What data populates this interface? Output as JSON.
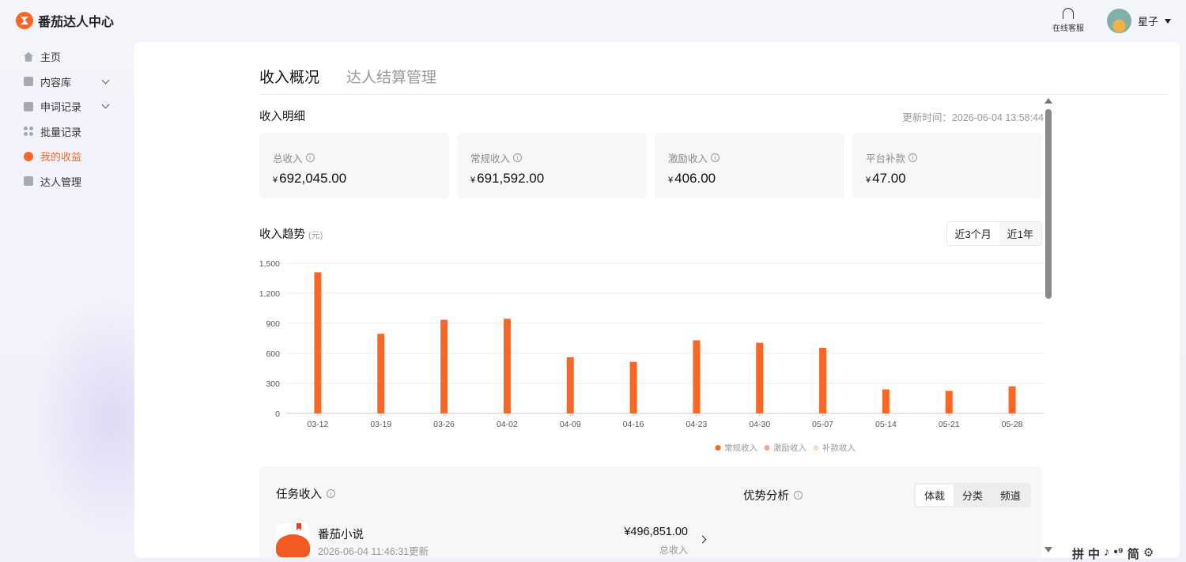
{
  "app": {
    "name": "番茄达人中心"
  },
  "header": {
    "support_label": "在线客服",
    "user_name": "星子"
  },
  "sidebar": {
    "items": [
      {
        "label": "主页",
        "icon": "home-icon"
      },
      {
        "label": "内容库",
        "icon": "content-library-icon",
        "expandable": true
      },
      {
        "label": "申词记录",
        "icon": "document-icon",
        "expandable": true
      },
      {
        "label": "批量记录",
        "icon": "grid-icon"
      },
      {
        "label": "我的收益",
        "icon": "earnings-icon",
        "active": true
      },
      {
        "label": "达人管理",
        "icon": "person-card-icon"
      }
    ]
  },
  "tabs": [
    {
      "label": "收入概况",
      "active": true
    },
    {
      "label": "达人结算管理",
      "active": false
    }
  ],
  "detail": {
    "title": "收入明细",
    "updated": "更新时间：2026-06-04 13:58:44",
    "cards": [
      {
        "label": "总收入",
        "currency": "¥",
        "value": "692,045.00"
      },
      {
        "label": "常规收入",
        "currency": "¥",
        "value": "691,592.00"
      },
      {
        "label": "激励收入",
        "currency": "¥",
        "value": "406.00"
      },
      {
        "label": "平台补款",
        "currency": "¥",
        "value": "47.00"
      }
    ]
  },
  "trend": {
    "title": "收入趋势",
    "unit": "(元)",
    "ranges": [
      {
        "label": "近3个月",
        "active": true
      },
      {
        "label": "近1年",
        "active": false
      }
    ]
  },
  "chart_data": {
    "type": "bar",
    "categories": [
      "03-12",
      "03-19",
      "03-26",
      "04-02",
      "04-09",
      "04-16",
      "04-23",
      "04-30",
      "05-07",
      "05-14",
      "05-21",
      "05-28"
    ],
    "series": [
      {
        "name": "常规收入",
        "color": "#fa6725",
        "values": [
          1410,
          795,
          935,
          945,
          560,
          515,
          730,
          705,
          655,
          240,
          225,
          270
        ]
      },
      {
        "name": "激励收入",
        "color": "#f4a98a",
        "values": [
          0,
          0,
          0,
          0,
          0,
          0,
          0,
          0,
          0,
          0,
          0,
          0
        ]
      },
      {
        "name": "补款收入",
        "color": "#fbd9cc",
        "values": [
          0,
          0,
          0,
          0,
          0,
          0,
          0,
          0,
          0,
          0,
          0,
          0
        ]
      }
    ],
    "yticks": [
      "0",
      "300",
      "600",
      "900",
      "1,200",
      "1,500"
    ],
    "ylim": [
      0,
      1500
    ],
    "grid": true,
    "legend_position": "bottom"
  },
  "task": {
    "title": "任务收入",
    "item": {
      "name": "番茄小说",
      "updated": "2026-06-04 11:46:31更新",
      "amount": "¥496,851.00",
      "amount_label": "总收入"
    }
  },
  "advantage": {
    "title": "优势分析",
    "segments": [
      {
        "label": "体裁",
        "active": true
      },
      {
        "label": "分类",
        "active": false
      },
      {
        "label": "频道",
        "active": false
      }
    ]
  },
  "ime": [
    "拼",
    "中",
    "♪",
    "•⁹",
    "简",
    "⚙"
  ]
}
